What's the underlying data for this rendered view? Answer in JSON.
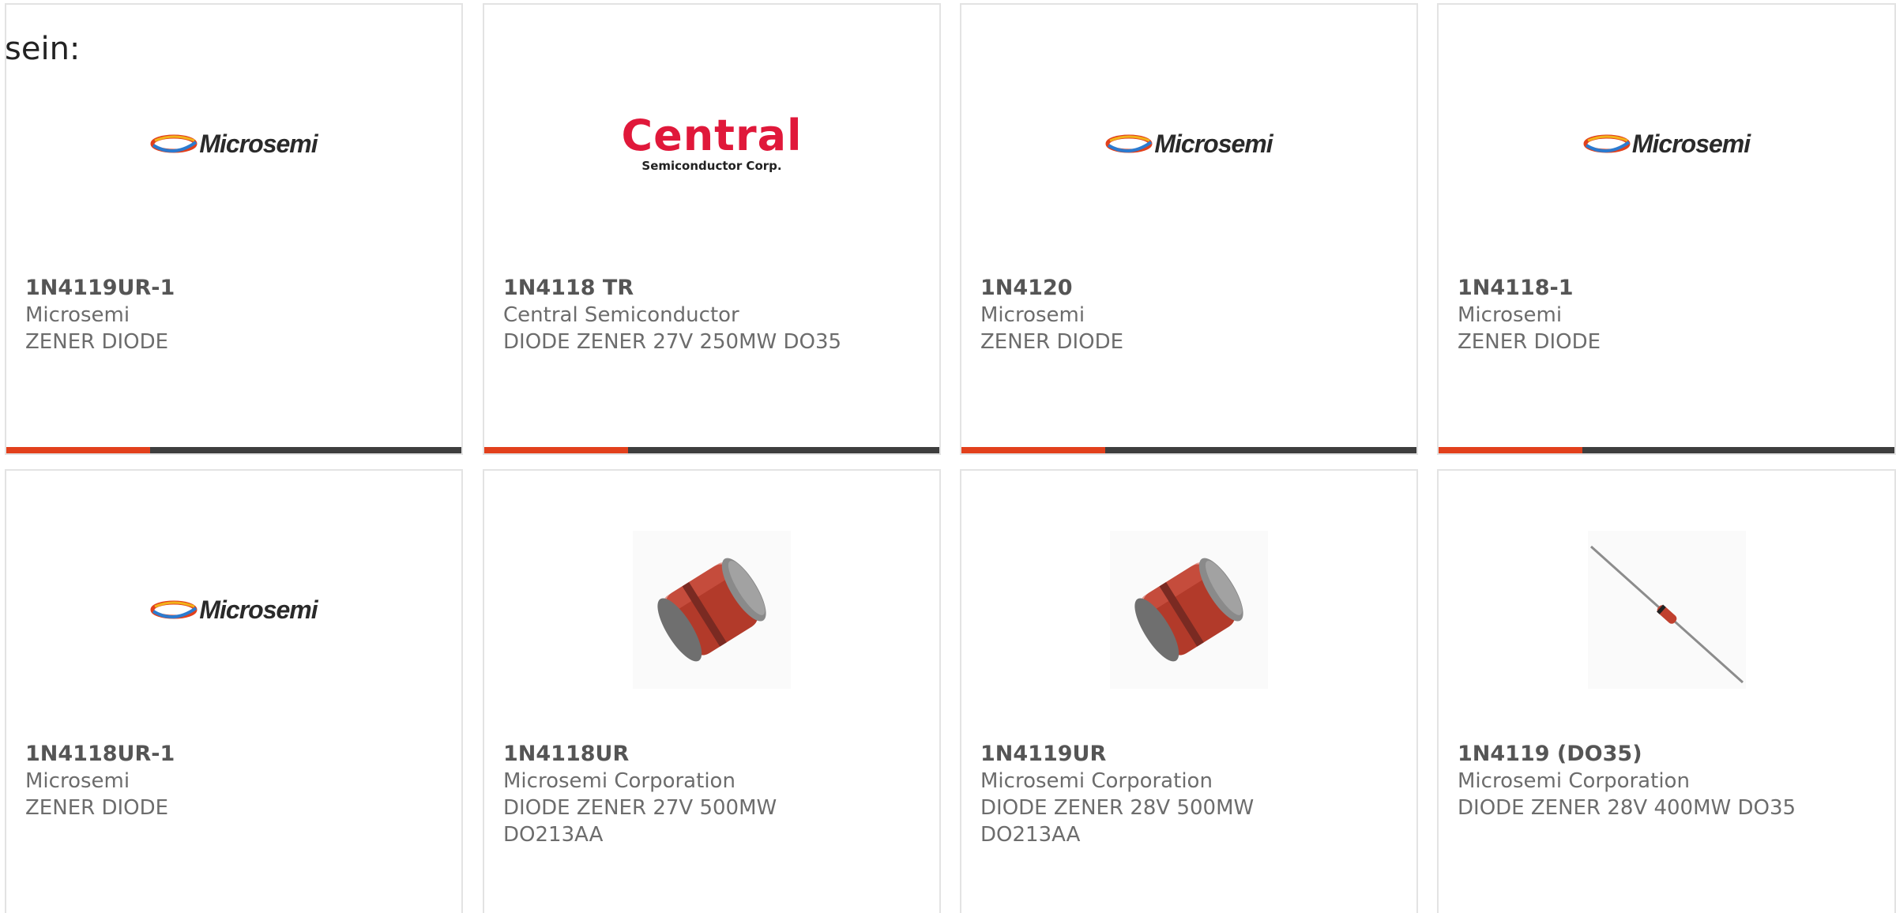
{
  "intro_text": "sein:",
  "colors": {
    "accent": "#e2401c",
    "bar": "#3e3e3e",
    "card_border": "#e3e3e3",
    "text": "#6c6c6c"
  },
  "products": [
    {
      "part_number": "1N4119UR-1",
      "manufacturer": "Microsemi",
      "description": "ZENER DIODE",
      "image": "microsemi-logo",
      "logo_text": "Microsemi"
    },
    {
      "part_number": "1N4118 TR",
      "manufacturer": "Central Semiconductor",
      "description": "DIODE ZENER 27V 250MW DO35",
      "image": "central-semiconductor-logo",
      "logo_text": "Central",
      "logo_subtext": "Semiconductor Corp."
    },
    {
      "part_number": "1N4120",
      "manufacturer": "Microsemi",
      "description": "ZENER DIODE",
      "image": "microsemi-logo",
      "logo_text": "Microsemi"
    },
    {
      "part_number": "1N4118-1",
      "manufacturer": "Microsemi",
      "description": "ZENER DIODE",
      "image": "microsemi-logo",
      "logo_text": "Microsemi"
    },
    {
      "part_number": "1N4118UR-1",
      "manufacturer": "Microsemi",
      "description": "ZENER DIODE",
      "image": "microsemi-logo",
      "logo_text": "Microsemi"
    },
    {
      "part_number": "1N4118UR",
      "manufacturer": "Microsemi Corporation",
      "description": "DIODE ZENER 27V 500MW DO213AA",
      "image": "melf-diode-photo"
    },
    {
      "part_number": "1N4119UR",
      "manufacturer": "Microsemi Corporation",
      "description": "DIODE ZENER 28V 500MW DO213AA",
      "image": "melf-diode-photo"
    },
    {
      "part_number": "1N4119 (DO35)",
      "manufacturer": "Microsemi Corporation",
      "description": "DIODE ZENER 28V 400MW DO35",
      "image": "axial-diode-photo"
    }
  ]
}
